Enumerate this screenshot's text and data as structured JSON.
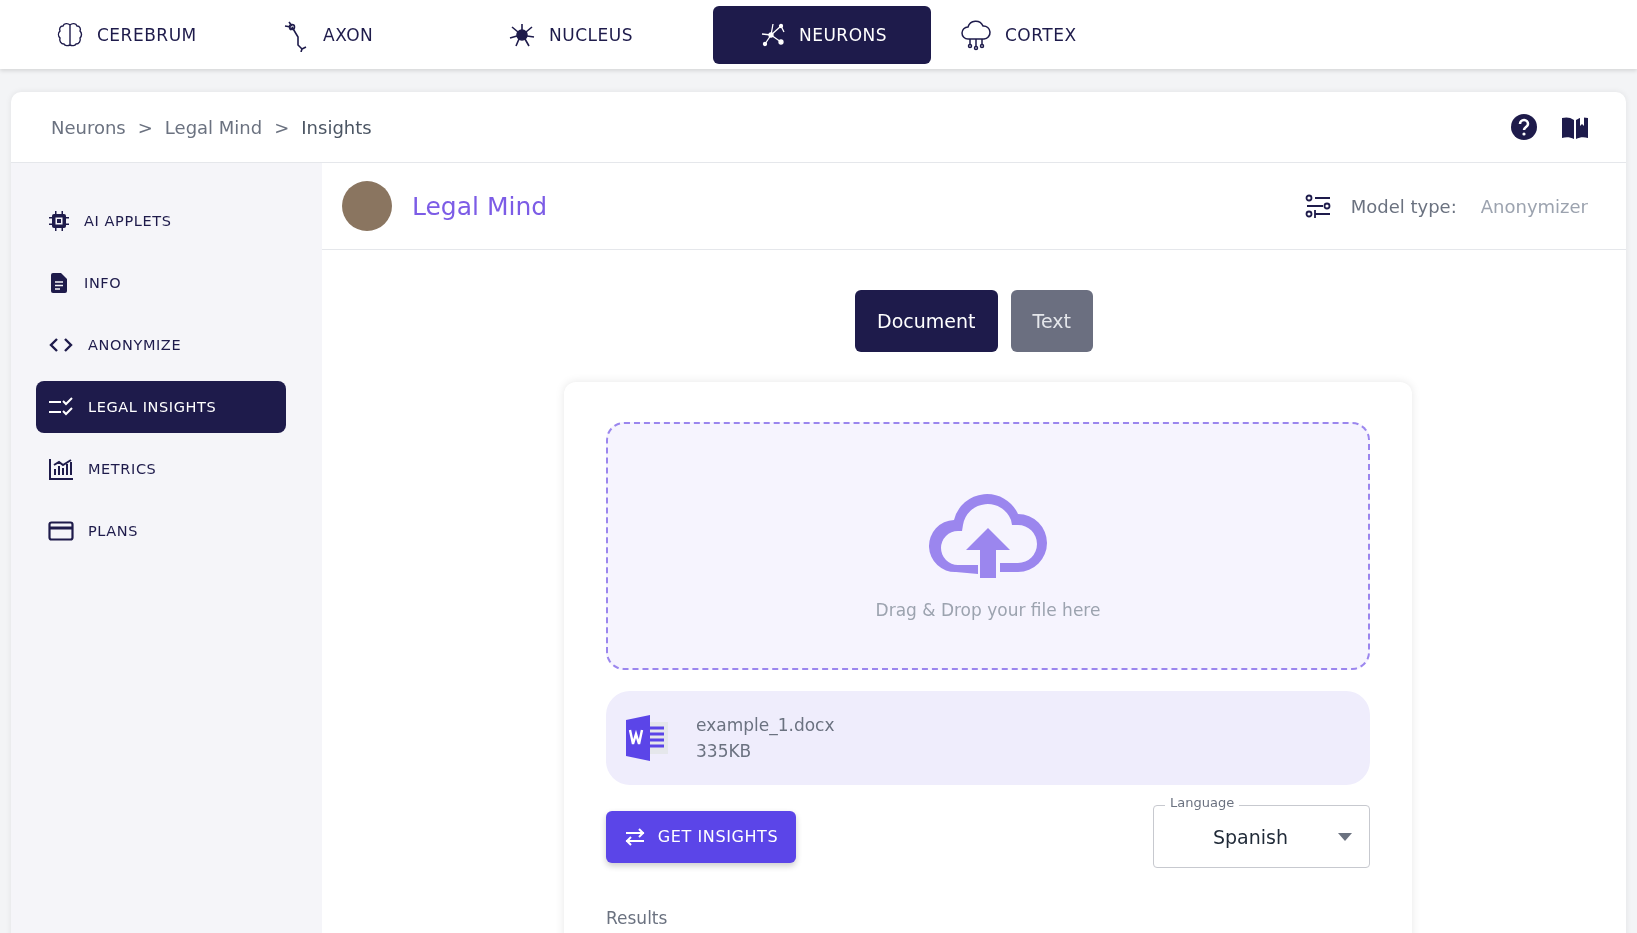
{
  "nav_tabs": [
    {
      "label": "CEREBRUM",
      "selected": false
    },
    {
      "label": "AXON",
      "selected": false
    },
    {
      "label": "NUCLEUS",
      "selected": false
    },
    {
      "label": "NEURONS",
      "selected": true
    },
    {
      "label": "CORTEX",
      "selected": false
    }
  ],
  "breadcrumb": [
    "Neurons",
    "Legal Mind",
    "Insights"
  ],
  "breadcrumb_separators": [
    ">",
    ">"
  ],
  "sidebar": {
    "items": [
      {
        "label": "AI APPLETS",
        "selected": false
      },
      {
        "label": "INFO",
        "selected": false
      },
      {
        "label": "ANONYMIZE",
        "selected": false
      },
      {
        "label": "LEGAL INSIGHTS",
        "selected": true
      },
      {
        "label": "METRICS",
        "selected": false
      },
      {
        "label": "PLANS",
        "selected": false
      }
    ]
  },
  "applet": {
    "title": "Legal Mind",
    "model_type_label": "Model type:",
    "model_type": "Anonymizer"
  },
  "mode_toggle": [
    {
      "label": "Document",
      "selected": true
    },
    {
      "label": "Text",
      "selected": false
    }
  ],
  "dropzone": {
    "text": "Drag & Drop your file here"
  },
  "file": {
    "name": "example_1.docx",
    "size": "335KB"
  },
  "action_button": "GET INSIGHTS",
  "language": {
    "label": "Language",
    "value": "Spanish"
  },
  "results_label": "Results"
}
